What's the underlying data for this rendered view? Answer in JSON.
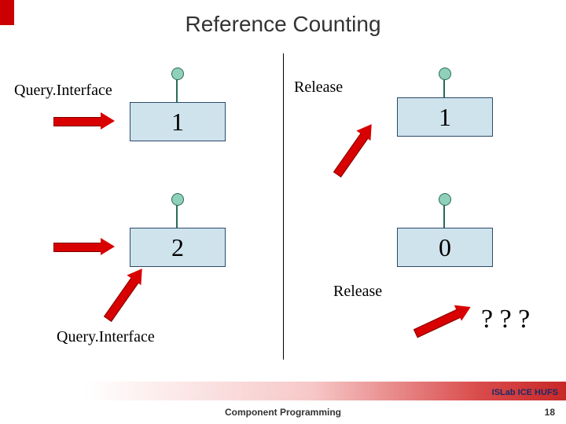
{
  "title": "Reference Counting",
  "labels": {
    "qi_top": "Query.Interface",
    "release_top": "Release",
    "release_bot": "Release",
    "qi_bot": "Query.Interface",
    "qmarks": "? ? ?"
  },
  "boxes": {
    "left_top": "1",
    "right_top": "1",
    "left_bot": "2",
    "right_bot": "0"
  },
  "footer": {
    "lab": "ISLab ICE HUFS",
    "subtitle": "Component Programming",
    "page": "18"
  }
}
